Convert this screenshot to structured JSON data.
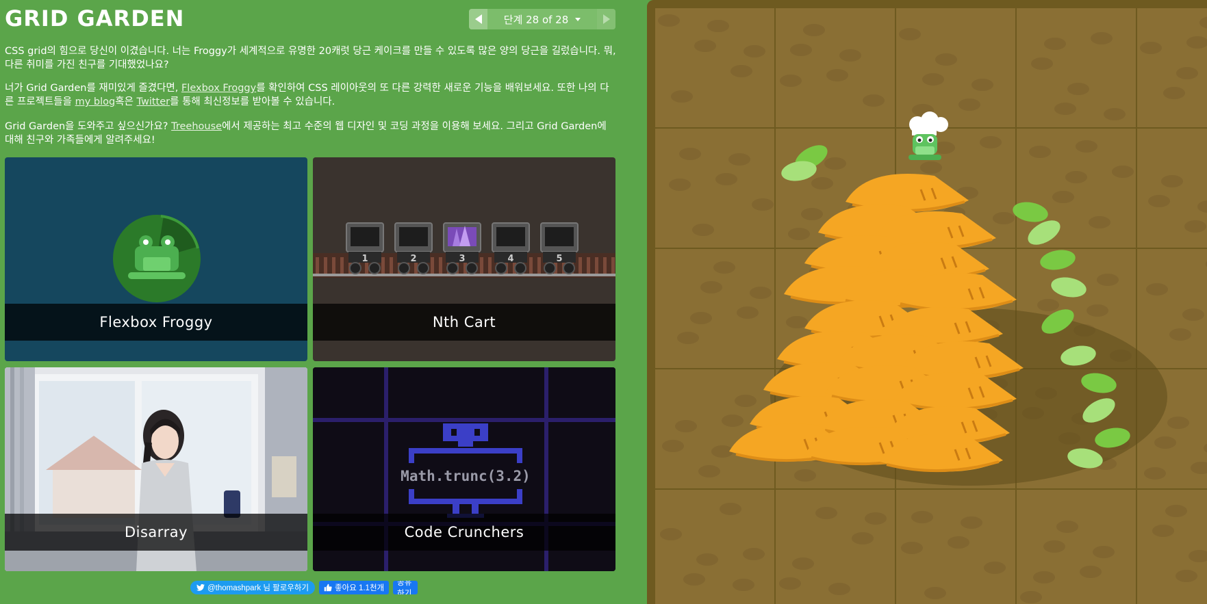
{
  "header": {
    "title": "GRID GARDEN",
    "level_label": "단계 28 of 28"
  },
  "intro": {
    "p1": "CSS grid의 힘으로 당신이 이겼습니다. 너는 Froggy가 세계적으로 유명한 20캐럿 당근 케이크를 만들 수 있도록 많은 양의 당근을 길렀습니다. 뭐, 다른 취미를 가진 친구를 기대했었나요?",
    "p2_a": "너가 Grid Garden를 재미있게 즐겼다면, ",
    "p2_link1": "Flexbox Froggy",
    "p2_b": "를 확인하여 CSS 레이아웃의 또 다른 강력한 새로운 기능을 배워보세요. 또한 나의 다른 프로젝트들을 ",
    "p2_link2": "my blog",
    "p2_c": "혹은 ",
    "p2_link3": "Twitter",
    "p2_d": "를 통해 최신정보를 받아볼 수 있습니다.",
    "p3_a": "Grid Garden을 도와주고 싶으신가요? ",
    "p3_link": "Treehouse",
    "p3_b": "에서 제공하는 최고 수준의 웹 디자인 및 코딩 과정을 이용해 보세요. 그리고 Grid Garden에 대해 친구와 가족들에게 알려주세요!"
  },
  "cards": [
    {
      "label": "Flexbox Froggy"
    },
    {
      "label": "Nth Cart"
    },
    {
      "label": "Disarray"
    },
    {
      "label": "Code Crunchers"
    }
  ],
  "cart_numbers": [
    "1",
    "2",
    "3",
    "4",
    "5"
  ],
  "code_text": "Math.trunc(3.2)",
  "social": {
    "twitter": "@thomashpark 님 팔로우하기",
    "like": "좋아요 1.1천개",
    "share": "공유하기"
  },
  "colors": {
    "background": "#5ba54a",
    "board": "#6e5a20",
    "carrot": "#f5a623",
    "leaf": "#7ac943"
  }
}
